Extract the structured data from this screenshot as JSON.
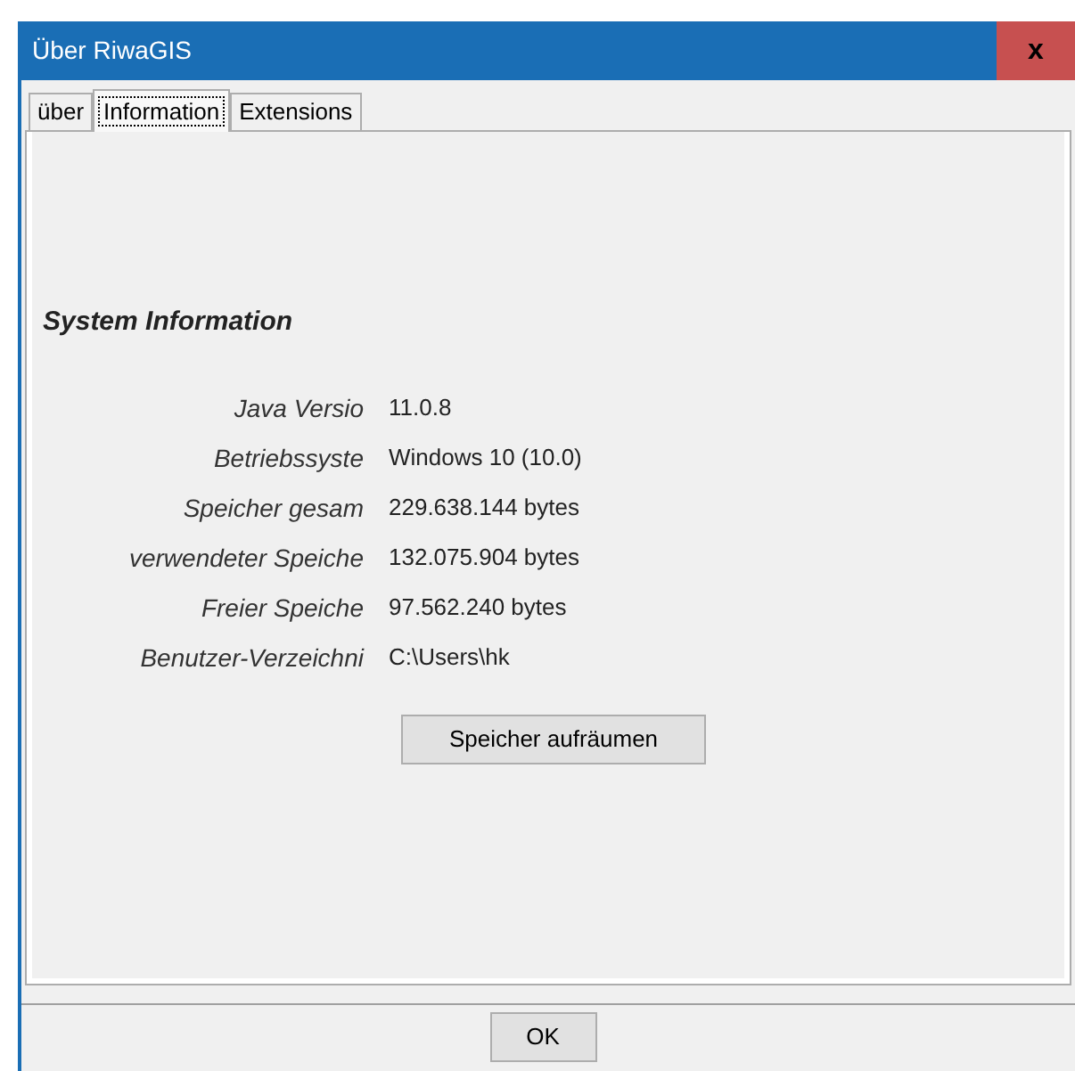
{
  "window": {
    "title": "Über RiwaGIS",
    "close": "x"
  },
  "tabs": [
    {
      "label": "über",
      "selected": false
    },
    {
      "label": "Information",
      "selected": true
    },
    {
      "label": "Extensions",
      "selected": false
    }
  ],
  "section_title": "System Information",
  "info_rows": [
    {
      "label": "Java Versio",
      "value": "11.0.8"
    },
    {
      "label": "Betriebssyste",
      "value": "Windows 10 (10.0)"
    },
    {
      "label": "Speicher gesam",
      "value": "229.638.144 bytes"
    },
    {
      "label": "verwendeter Speiche",
      "value": "132.075.904 bytes"
    },
    {
      "label": "Freier Speiche",
      "value": "97.562.240 bytes"
    },
    {
      "label": "Benutzer-Verzeichni",
      "value": "C:\\Users\\hk"
    }
  ],
  "action_button": "Speicher aufräumen",
  "buttons": [
    "OK"
  ]
}
